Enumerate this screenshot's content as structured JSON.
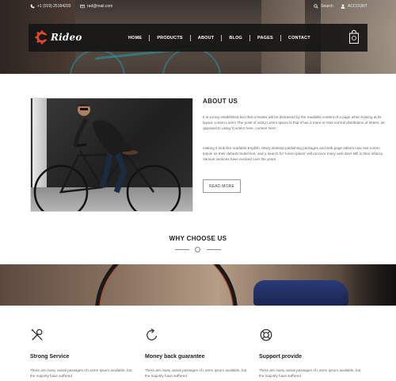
{
  "topbar": {
    "phone": "+1 (019) 25184203",
    "email": "rad@mail.com",
    "search_label": "Search",
    "account_label": "ACCOUNT"
  },
  "brand": {
    "logo_text": "Rideo",
    "accent": "#e2472f"
  },
  "nav": {
    "items": [
      {
        "label": "HOME"
      },
      {
        "label": "PRODUCTS"
      },
      {
        "label": "ABOUT"
      },
      {
        "label": "BLOG"
      },
      {
        "label": "PAGES"
      },
      {
        "label": "CONTACT"
      }
    ]
  },
  "about": {
    "title": "ABOUT US",
    "paragraph1": "It is a long established fact that a reader will be distracted by the readable content of a page when looking at its layout. Lorem Lorem The point of using Lorem Ipsum is that it has a more-or-less normal distribution of letters, as opposed to using 'Content here, content here',",
    "paragraph2": "making it look like readable English. Many desktop publishing packages and web page editors now use Lorem Ipsum as their default model text, and a search for 'lorem ipsum' will uncover many web sites still in their infancy. Various versions have evolved over the years,",
    "button_label": "READ MORE"
  },
  "why": {
    "title": "WHY CHOOSE US"
  },
  "features": [
    {
      "icon": "tools-icon",
      "title": "Strong Service",
      "text": "There are many variati passages of Lorem Ipsum available, but the majority have suffered"
    },
    {
      "icon": "refresh-icon",
      "title": "Money back guarantee",
      "text": "There are many variati passages of Lorem Ipsum available, but the majority have suffered"
    },
    {
      "icon": "lifebuoy-icon",
      "title": "Support provide",
      "text": "There are many variati passages of Lorem Ipsum available, but the majority have suffered"
    }
  ]
}
